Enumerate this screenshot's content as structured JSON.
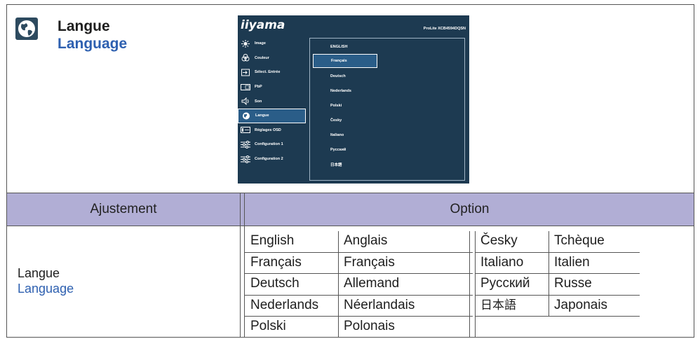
{
  "header": {
    "icon": "globe-icon",
    "title_fr": "Langue",
    "title_en": "Language"
  },
  "osd": {
    "logo": "iiyama",
    "model": "ProLite XCB4594DQSN",
    "menu": [
      {
        "label": "Image",
        "icon": "brightness-icon"
      },
      {
        "label": "Couleur",
        "icon": "color-icon"
      },
      {
        "label": "Sélect. Entrée",
        "icon": "input-icon"
      },
      {
        "label": "PbP",
        "icon": "pbp-icon"
      },
      {
        "label": "Son",
        "icon": "speaker-icon"
      },
      {
        "label": "Langue",
        "icon": "globe-icon"
      },
      {
        "label": "Réglages OSD",
        "icon": "osd-icon"
      },
      {
        "label": "Configuration 1",
        "icon": "sliders-icon"
      },
      {
        "label": "Configuration 2",
        "icon": "sliders-icon"
      }
    ],
    "selected_menu": "Langue",
    "options": [
      "ENGLISH",
      "Français",
      "Deutsch",
      "Nederlands",
      "Polski",
      "Česky",
      "Italiano",
      "Русский",
      "日本語"
    ],
    "selected_option": "Français"
  },
  "table": {
    "col_adjust": "Ajustement",
    "col_option": "Option",
    "row_label_fr": "Langue",
    "row_label_en": "Language",
    "left": [
      [
        "English",
        "Anglais"
      ],
      [
        "Français",
        "Français"
      ],
      [
        "Deutsch",
        "Allemand"
      ],
      [
        "Nederlands",
        "Néerlandais"
      ],
      [
        "Polski",
        "Polonais"
      ]
    ],
    "right": [
      [
        "Česky",
        "Tchèque"
      ],
      [
        "Italiano",
        "Italien"
      ],
      [
        "Русский",
        "Russe"
      ],
      [
        "日本語",
        "Japonais"
      ]
    ]
  }
}
